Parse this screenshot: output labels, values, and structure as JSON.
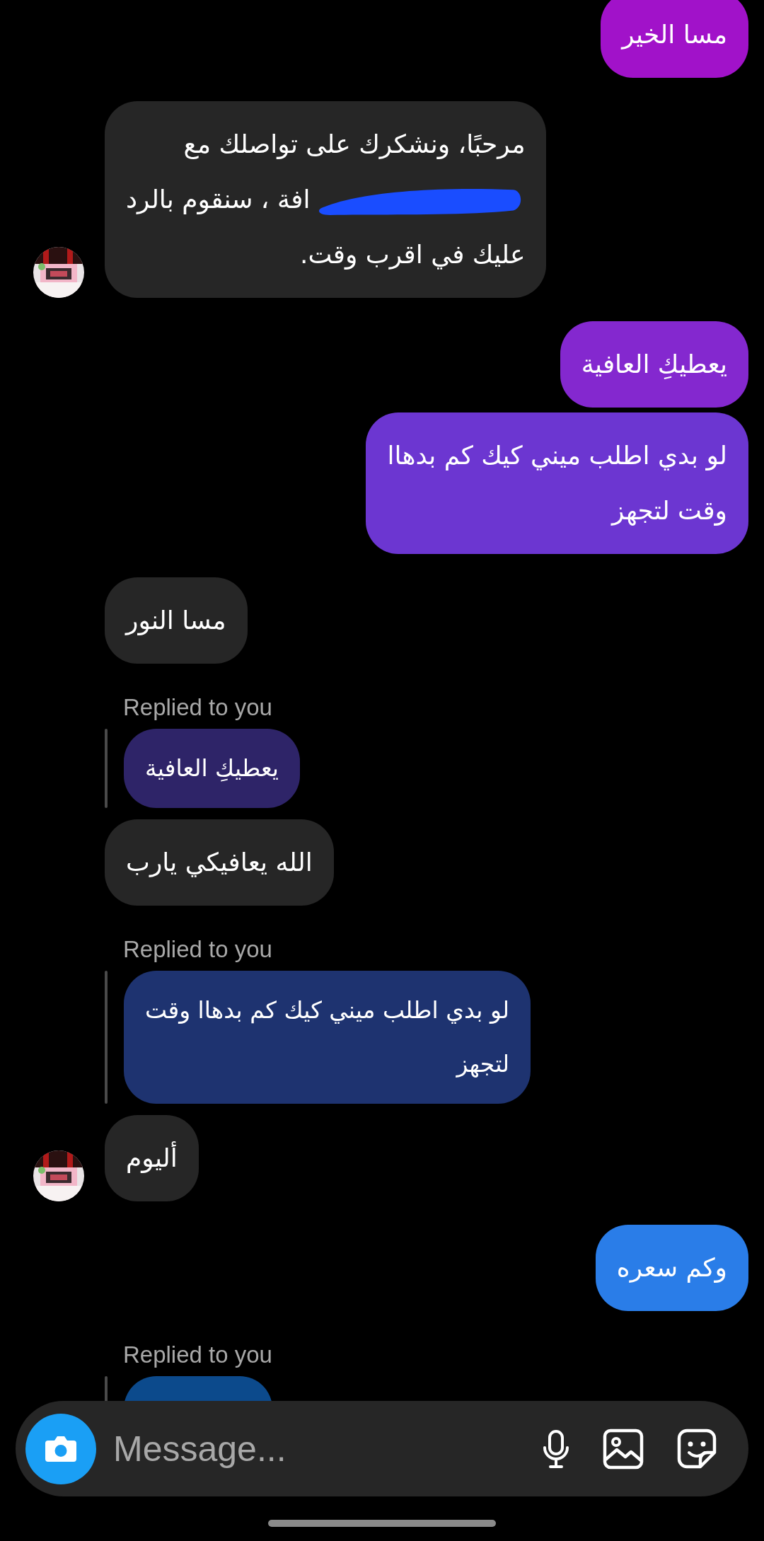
{
  "messages": [
    {
      "kind": "sent",
      "lines": [
        "مسا الخير"
      ]
    },
    {
      "kind": "received",
      "avatar": true,
      "lines": [
        {
          "kind": "text",
          "text": "مرحبًا، ونشكرك على تواصلك مع"
        },
        {
          "kind": "redacted",
          "text": "افة ، سنقوم بالرد"
        },
        {
          "kind": "text",
          "text": "عليك في اقرب وقت."
        }
      ]
    },
    {
      "kind": "sent",
      "lines": [
        "يعطيكِ العافية"
      ]
    },
    {
      "kind": "sent",
      "lines": [
        "لو بدي اطلب ميني كيك كم بدهاا",
        "وقت لتجهز"
      ]
    },
    {
      "kind": "received",
      "avatar": false,
      "lines": [
        "مسا النور"
      ]
    },
    {
      "kind": "quote",
      "label": "Replied to you",
      "lines": [
        "يعطيكِ العافية"
      ]
    },
    {
      "kind": "received",
      "avatar": false,
      "lines": [
        "الله يعافيكي يارب"
      ]
    },
    {
      "kind": "quote",
      "label": "Replied to you",
      "lines": [
        "لو بدي اطلب ميني كيك كم بدهاا وقت",
        "لتجهز"
      ]
    },
    {
      "kind": "received",
      "avatar": true,
      "lines": [
        "أليوم"
      ]
    },
    {
      "kind": "sent",
      "lines": [
        "وكم سعره"
      ]
    },
    {
      "kind": "quote",
      "label": "Replied to you"
    }
  ],
  "composer": {
    "placeholder": "Message..."
  }
}
